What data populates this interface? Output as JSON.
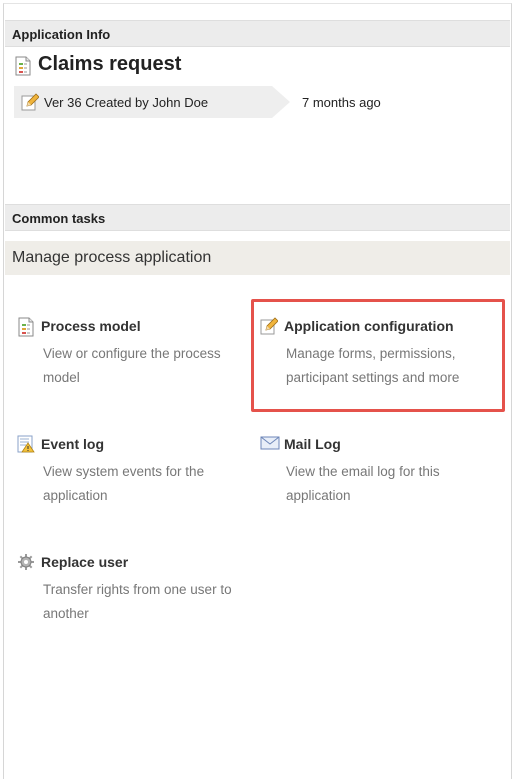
{
  "app_info": {
    "section_title": "Application Info",
    "app_name": "Claims request",
    "version_label": "Ver 36 Created by John Doe",
    "version_time": "7 months ago"
  },
  "common_tasks": {
    "section_title": "Common tasks",
    "group_title": "Manage process application",
    "tasks": [
      {
        "title": "Process model",
        "desc": "View or configure the process model",
        "icon": "document-flow-icon"
      },
      {
        "title": "Application configuration",
        "desc": "Manage forms, permissions, participant settings and more",
        "icon": "pencil-icon"
      },
      {
        "title": "Event log",
        "desc": "View system events for the application",
        "icon": "event-log-warning-icon"
      },
      {
        "title": "Mail Log",
        "desc": "View the email log for this application",
        "icon": "envelope-icon"
      },
      {
        "title": "Replace user",
        "desc": "Transfer rights from one user to another",
        "icon": "gear-icon"
      }
    ]
  },
  "colors": {
    "highlight": "#e5524b",
    "section_header_bg": "#ececec",
    "manage_bar_bg": "#efede8"
  }
}
